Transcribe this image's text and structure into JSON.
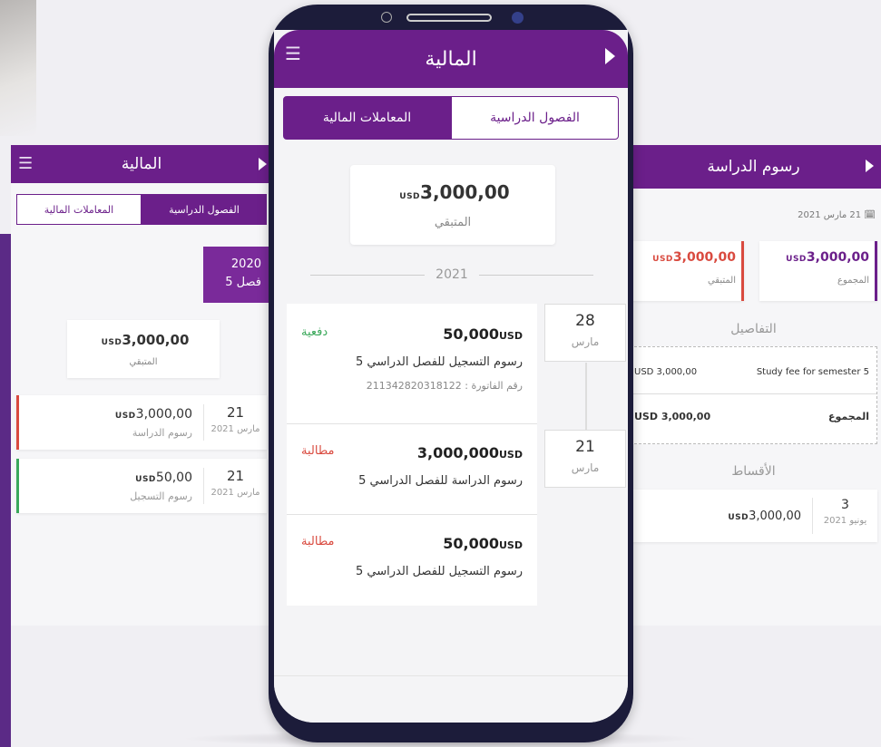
{
  "colors": {
    "brand": "#6b1f8a",
    "paid": "#3aa85a",
    "due": "#d94a3f"
  },
  "left": {
    "title": "المالية",
    "tab_semesters": "الفصول الدراسية",
    "tab_transactions": "المعاملات المالية",
    "year": "2020",
    "semester": "فصل 5",
    "remaining_amount": "3,000,00",
    "currency": "USD",
    "remaining_label": "المتبقي",
    "rows": [
      {
        "day": "21",
        "month": "مارس 2021",
        "amount": "3,000,00",
        "title": "رسوم الدراسة",
        "status": "due"
      },
      {
        "day": "21",
        "month": "مارس 2021",
        "amount": "50,00",
        "title": "رسوم التسجيل",
        "status": "paid"
      }
    ]
  },
  "phone": {
    "title": "المالية",
    "tab_semesters": "الفصول الدراسية",
    "tab_transactions": "المعاملات المالية",
    "remaining_amount": "3,000,00",
    "currency": "USD",
    "remaining_label": "المتبقي",
    "year": "2021",
    "transactions": [
      {
        "amount": "50,000",
        "currency": "USD",
        "status": "دفعية",
        "desc": "رسوم التسجيل للفصل الدراسي 5",
        "invoice": "رقم الفاتورة : 211342820318122"
      },
      {
        "amount": "3,000,000",
        "currency": "USD",
        "status": "مطالبة",
        "desc": "رسوم الدراسة للفصل الدراسي 5"
      },
      {
        "amount": "50,000",
        "currency": "USD",
        "status": "مطالبة",
        "desc": "رسوم التسجيل للفصل الدراسي 5"
      }
    ],
    "dates": [
      {
        "day": "28",
        "month": "مارس"
      },
      {
        "day": "21",
        "month": "مارس"
      }
    ]
  },
  "right": {
    "title": "رسوم الدراسة",
    "date": "21 مارس 2021",
    "total_amount": "3,000,00",
    "total_label": "المجموع",
    "remaining_amount": "3,000,00",
    "remaining_label": "المتبقي",
    "currency": "USD",
    "details_heading": "التفاصيل",
    "detail_desc": "Study fee for semester 5",
    "detail_amount": "USD 3,000,00",
    "detail_total_label": "المجموع",
    "detail_total_amount": "USD 3,000,00",
    "installments_heading": "الأقساط",
    "installment": {
      "day": "3",
      "month": "يونيو 2021",
      "amount": "3,000,00"
    }
  }
}
